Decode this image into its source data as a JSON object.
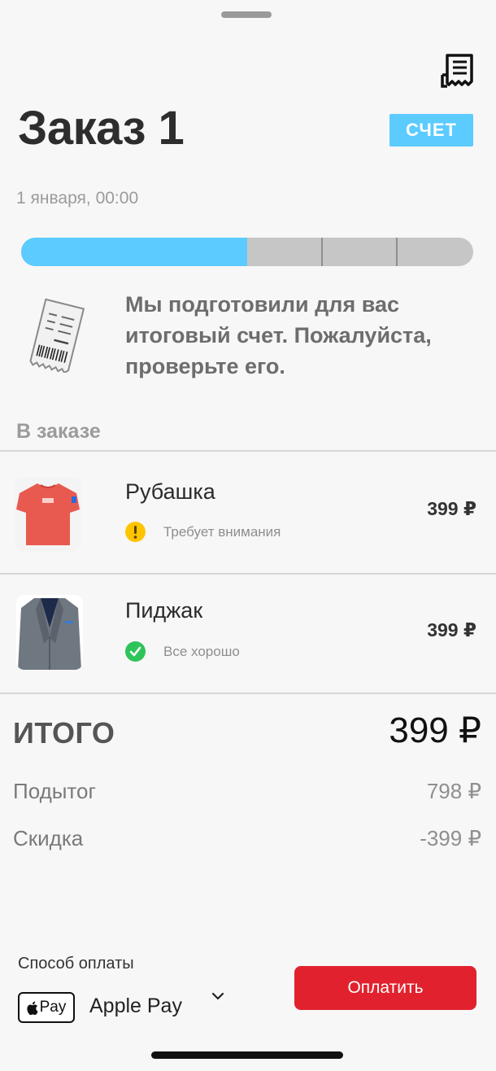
{
  "order": {
    "title": "Заказ 1",
    "badge": "СЧЕТ",
    "date": "1 января, 00:00",
    "progress": {
      "fraction": 0.5,
      "segments": 4
    },
    "message": "Мы подготовили для вас итоговый счет. Пожалуйста, проверьте его."
  },
  "section_title": "В заказе",
  "items": [
    {
      "name": "Рубашка",
      "status": "Требует внимания",
      "status_kind": "warning",
      "status_color": "#ffc400",
      "icon": "warning-icon",
      "price": "399 ₽"
    },
    {
      "name": "Пиджак",
      "status": "Все хорошо",
      "status_kind": "ok",
      "status_color": "#2ec45a",
      "icon": "check-icon",
      "price": "399 ₽"
    }
  ],
  "summary": {
    "total_label": "ИТОГО",
    "total_value": "399 ₽",
    "subtotal_label": "Подытог",
    "subtotal_value": "798 ₽",
    "discount_label": "Скидка",
    "discount_value": "-399 ₽"
  },
  "payment": {
    "label": "Способ оплаты",
    "badge_text": "Pay",
    "method": "Apple Pay",
    "button": "Оплатить"
  },
  "colors": {
    "accent": "#5ccbff",
    "pay_button": "#e1222e",
    "background": "#f7f7f7"
  }
}
